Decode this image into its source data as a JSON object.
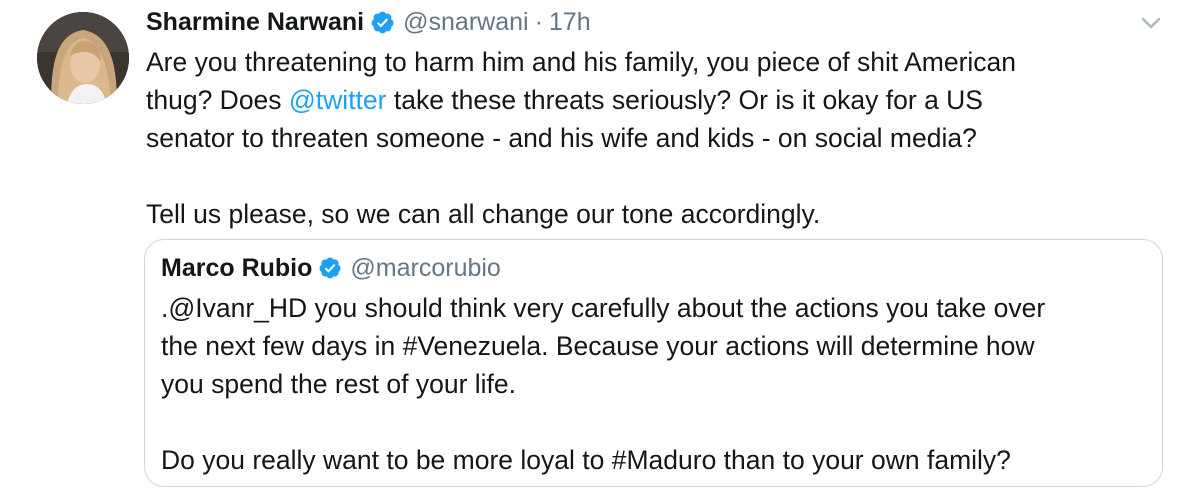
{
  "tweet": {
    "author": {
      "name": "Sharmine Narwani",
      "handle": "@snarwani",
      "separator": "·",
      "time": "17h",
      "avatar_icon": "profile-photo"
    },
    "text": {
      "line1": "Are you threatening to harm him and his family, you piece of shit American",
      "line2_pre": "thug? Does ",
      "line2_mention": "@twitter",
      "line2_post": " take these threats seriously? Or is it okay for a US",
      "line3": "senator to threaten someone - and his wife and kids - on social media?",
      "line4": "Tell us please, so we can all change our tone accordingly."
    },
    "menu_icon": "chevron-down-icon"
  },
  "quoted": {
    "author": {
      "name": "Marco Rubio",
      "handle": "@marcorubio"
    },
    "text": {
      "line1": ".@Ivanr_HD you should think very carefully about the actions you take over",
      "line2": "the next few days in #Venezuela. Because your actions will determine how",
      "line3": "you spend the rest of your life.",
      "line4": "Do you really want to be more loyal to #Maduro than to your own family?"
    }
  },
  "colors": {
    "text": "#14171a",
    "muted": "#657786",
    "link": "#1da1f2",
    "verified": "#1da1f2",
    "border": "#ccd6dd"
  }
}
